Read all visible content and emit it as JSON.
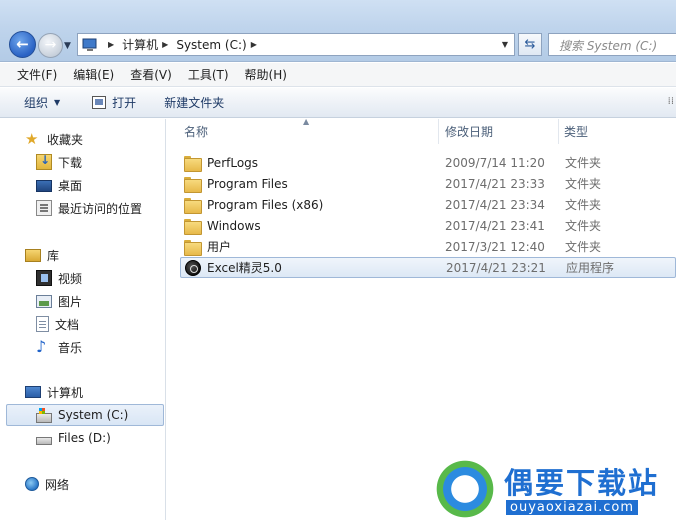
{
  "address": {
    "path": [
      "计算机",
      "System (C:)"
    ],
    "search_placeholder": "搜索 System (C:)"
  },
  "menu": [
    "文件(F)",
    "编辑(E)",
    "查看(V)",
    "工具(T)",
    "帮助(H)"
  ],
  "toolbar": {
    "organize": "组织",
    "burn": "打开",
    "new_folder": "新建文件夹"
  },
  "sidebar": {
    "favorites": {
      "label": "收藏夹",
      "items": [
        "下载",
        "桌面",
        "最近访问的位置"
      ]
    },
    "libraries": {
      "label": "库",
      "items": [
        "视频",
        "图片",
        "文档",
        "音乐"
      ]
    },
    "computer": {
      "label": "计算机",
      "items": [
        "System (C:)",
        "Files (D:)"
      ]
    },
    "network": {
      "label": "网络"
    }
  },
  "columns": {
    "name": "名称",
    "date": "修改日期",
    "type": "类型"
  },
  "files": [
    {
      "name": "PerfLogs",
      "date": "2009/7/14 11:20",
      "type": "文件夹"
    },
    {
      "name": "Program Files",
      "date": "2017/4/21 23:33",
      "type": "文件夹"
    },
    {
      "name": "Program Files (x86)",
      "date": "2017/4/21 23:34",
      "type": "文件夹"
    },
    {
      "name": "Windows",
      "date": "2017/4/21 23:41",
      "type": "文件夹"
    },
    {
      "name": "用户",
      "date": "2017/3/21 12:40",
      "type": "文件夹"
    },
    {
      "name": "Excel精灵5.0",
      "date": "2017/4/21 23:21",
      "type": "应用程序"
    }
  ],
  "watermark": {
    "title": "偶要下载站",
    "url": "ouyaoxiazai.com"
  }
}
